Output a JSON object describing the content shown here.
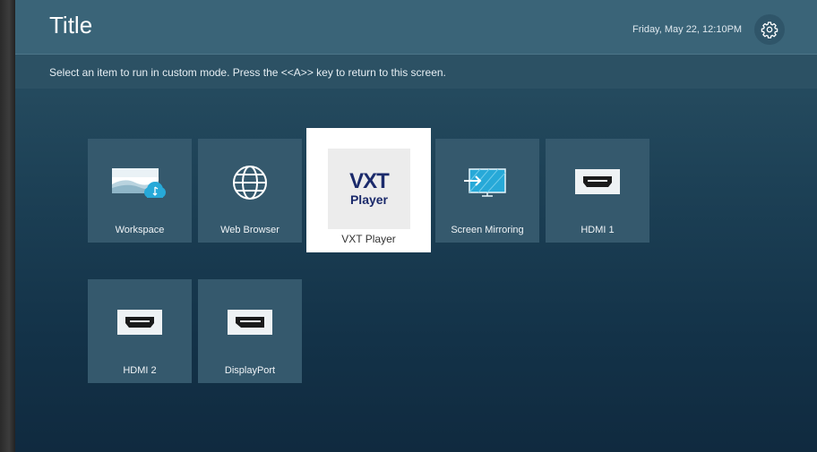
{
  "header": {
    "title": "Title",
    "datetime": "Friday, May 22, 12:10PM",
    "settings_icon": "gear-icon"
  },
  "instruction": "Select an item to run in custom mode. Press the <<A>> key to return to this screen.",
  "tiles": [
    {
      "label": "Workspace",
      "icon": "workspace-icon"
    },
    {
      "label": "Web Browser",
      "icon": "globe-icon"
    },
    {
      "label": "VXT Player",
      "icon": "vxt-player-logo",
      "logo_main": "VXT",
      "logo_sub": "Player",
      "selected": true
    },
    {
      "label": "Screen Mirroring",
      "icon": "screen-mirroring-icon"
    },
    {
      "label": "HDMI 1",
      "icon": "hdmi-port-icon"
    },
    {
      "label": "HDMI 2",
      "icon": "hdmi-port-icon"
    },
    {
      "label": "DisplayPort",
      "icon": "displayport-icon"
    }
  ],
  "colors": {
    "header_bg": "#3a6478",
    "tile_bg": "#35596d",
    "selected_tile_bg": "#ffffff",
    "vxt_brand": "#1b2a6b",
    "accent_cyan": "#27a9d8"
  }
}
